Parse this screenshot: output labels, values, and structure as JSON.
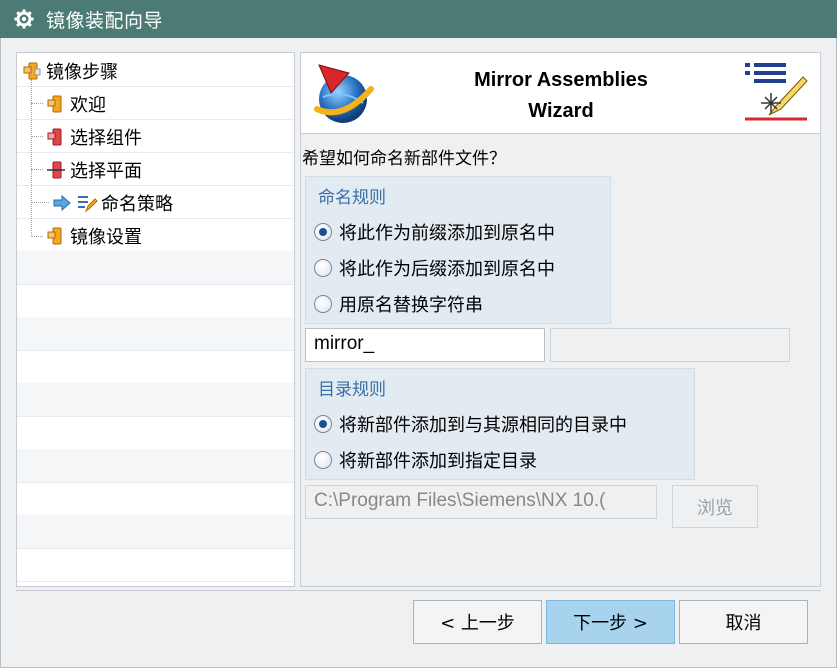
{
  "window": {
    "title": "镜像装配向导"
  },
  "tree": {
    "items": [
      {
        "label": "镜像步骤",
        "icon": "assembly-icon"
      },
      {
        "label": "欢迎",
        "icon": "assembly-icon"
      },
      {
        "label": "选择组件",
        "icon": "assembly-red-icon"
      },
      {
        "label": "选择平面",
        "icon": "assembly-plane-icon"
      },
      {
        "label": "命名策略",
        "icon": "current-step-arrow-icon",
        "current": true
      },
      {
        "label": "镜像设置",
        "icon": "assembly-icon"
      }
    ]
  },
  "banner": {
    "title_line1": "Mirror Assemblies",
    "title_line2": "Wizard",
    "logo_icon": "nx-globe-logo",
    "decor_icon": "wizard-list-pen-icon"
  },
  "prompt": "希望如何命名新部件文件？",
  "naming_rules": {
    "title": "命名规则",
    "options": [
      {
        "label": "将此作为前缀添加到原名中",
        "checked": true
      },
      {
        "label": "将此作为后缀添加到原名中",
        "checked": false
      },
      {
        "label": "用原名替换字符串",
        "checked": false
      }
    ],
    "prefix_value": "mirror_",
    "replace_value": ""
  },
  "directory_rules": {
    "title": "目录规则",
    "options": [
      {
        "label": "将新部件添加到与其源相同的目录中",
        "checked": true
      },
      {
        "label": "将新部件添加到指定目录",
        "checked": false
      }
    ],
    "path_value": "C:\\Program Files\\Siemens\\NX 10.(",
    "browse_label": "浏览"
  },
  "buttons": {
    "back": "< 上一步",
    "next": "下一步 >",
    "cancel": "取消"
  },
  "colors": {
    "titlebar": "#4b7b74",
    "group_title": "#3a6ea5",
    "group_bg": "#e3ebf2",
    "primary_button": "#a7d3ef"
  }
}
